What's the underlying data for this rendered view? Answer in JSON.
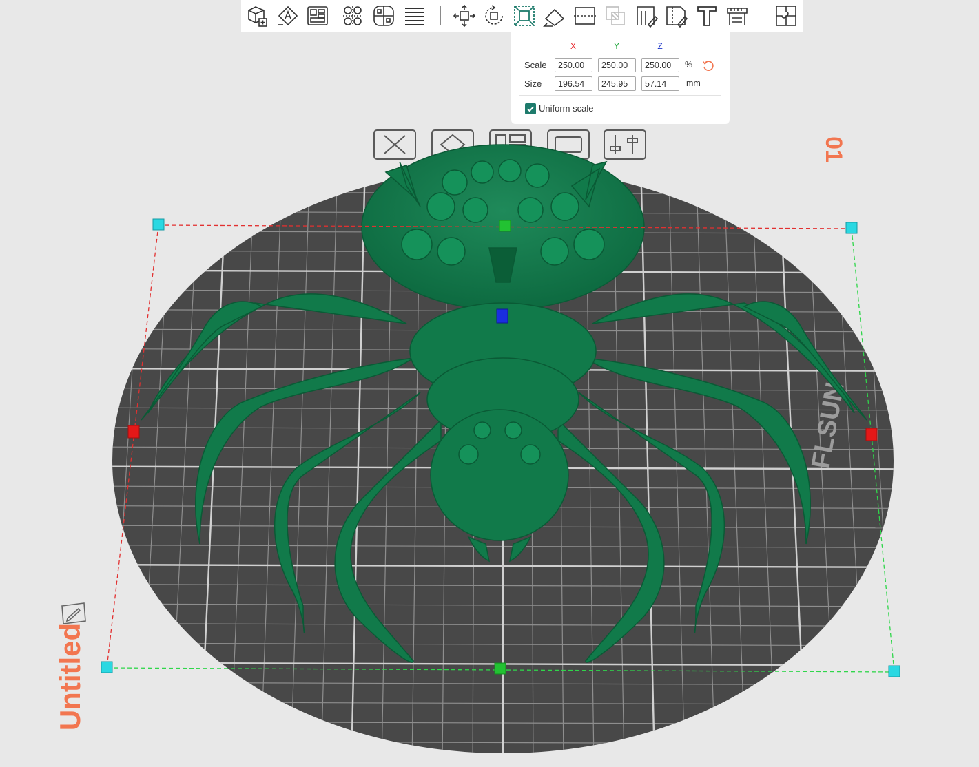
{
  "toolbar": {
    "tools": [
      {
        "name": "add-object-icon"
      },
      {
        "name": "auto-orient-icon"
      },
      {
        "name": "arrange-icon"
      },
      {
        "name": "split-to-objects-icon"
      },
      {
        "name": "split-to-parts-icon"
      },
      {
        "name": "layers-icon"
      },
      {
        "name": "move-icon"
      },
      {
        "name": "rotate-icon"
      },
      {
        "name": "scale-icon"
      },
      {
        "name": "lay-on-face-icon"
      },
      {
        "name": "cut-icon"
      },
      {
        "name": "mesh-boolean-icon"
      },
      {
        "name": "support-painting-icon"
      },
      {
        "name": "seam-painting-icon"
      },
      {
        "name": "text-shape-icon"
      },
      {
        "name": "measure-icon"
      },
      {
        "name": "assembly-icon"
      }
    ],
    "active_tool": "scale-icon"
  },
  "scale_panel": {
    "axis_x": "X",
    "axis_y": "Y",
    "axis_z": "Z",
    "scale_label": "Scale",
    "size_label": "Size",
    "scale_x": "250.00",
    "scale_y": "250.00",
    "scale_z": "250.00",
    "scale_unit": "%",
    "size_x": "196.54",
    "size_y": "245.95",
    "size_z": "57.14",
    "size_unit": "mm",
    "uniform_scale_label": "Uniform scale",
    "uniform_scale_checked": true,
    "colors": {
      "x": "#e8262b",
      "y": "#1ea53a",
      "z": "#1c35c9",
      "accent": "#1e7b6c",
      "reset": "#f27650"
    }
  },
  "plate": {
    "number": "01",
    "name": "Untitled",
    "name_color": "#f27650",
    "plate_icons": [
      {
        "name": "remove-plate-icon"
      },
      {
        "name": "auto-orient-plate-icon"
      },
      {
        "name": "arrange-plate-icon"
      },
      {
        "name": "lock-plate-icon"
      },
      {
        "name": "plate-settings-icon"
      }
    ]
  },
  "bed_logo": "FLSUN"
}
